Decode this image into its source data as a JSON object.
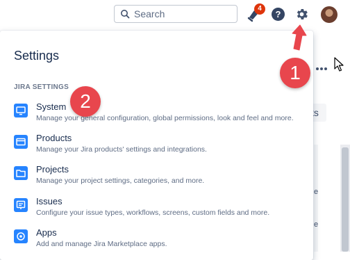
{
  "topbar": {
    "search_placeholder": "Search",
    "notification_count": "4"
  },
  "annotations": {
    "step1": "1",
    "step2": "2"
  },
  "background": {
    "partial_button": "ts",
    "fragment_1": "e",
    "fragment_2": "e"
  },
  "settings": {
    "title": "Settings",
    "section_label": "JIRA SETTINGS",
    "items": [
      {
        "name": "System",
        "desc": "Manage your general configuration, global permissions, look and feel and more.",
        "icon": "monitor-icon"
      },
      {
        "name": "Products",
        "desc": "Manage your Jira products' settings and integrations.",
        "icon": "products-icon"
      },
      {
        "name": "Projects",
        "desc": "Manage your project settings, categories, and more.",
        "icon": "folder-icon"
      },
      {
        "name": "Issues",
        "desc": "Configure your issue types, workflows, screens, custom fields and more.",
        "icon": "issues-icon"
      },
      {
        "name": "Apps",
        "desc": "Add and manage Jira Marketplace apps.",
        "icon": "apps-icon"
      }
    ]
  },
  "colors": {
    "accent": "#2684ff",
    "badge": "#de350b",
    "annotation": "#e8464d"
  }
}
